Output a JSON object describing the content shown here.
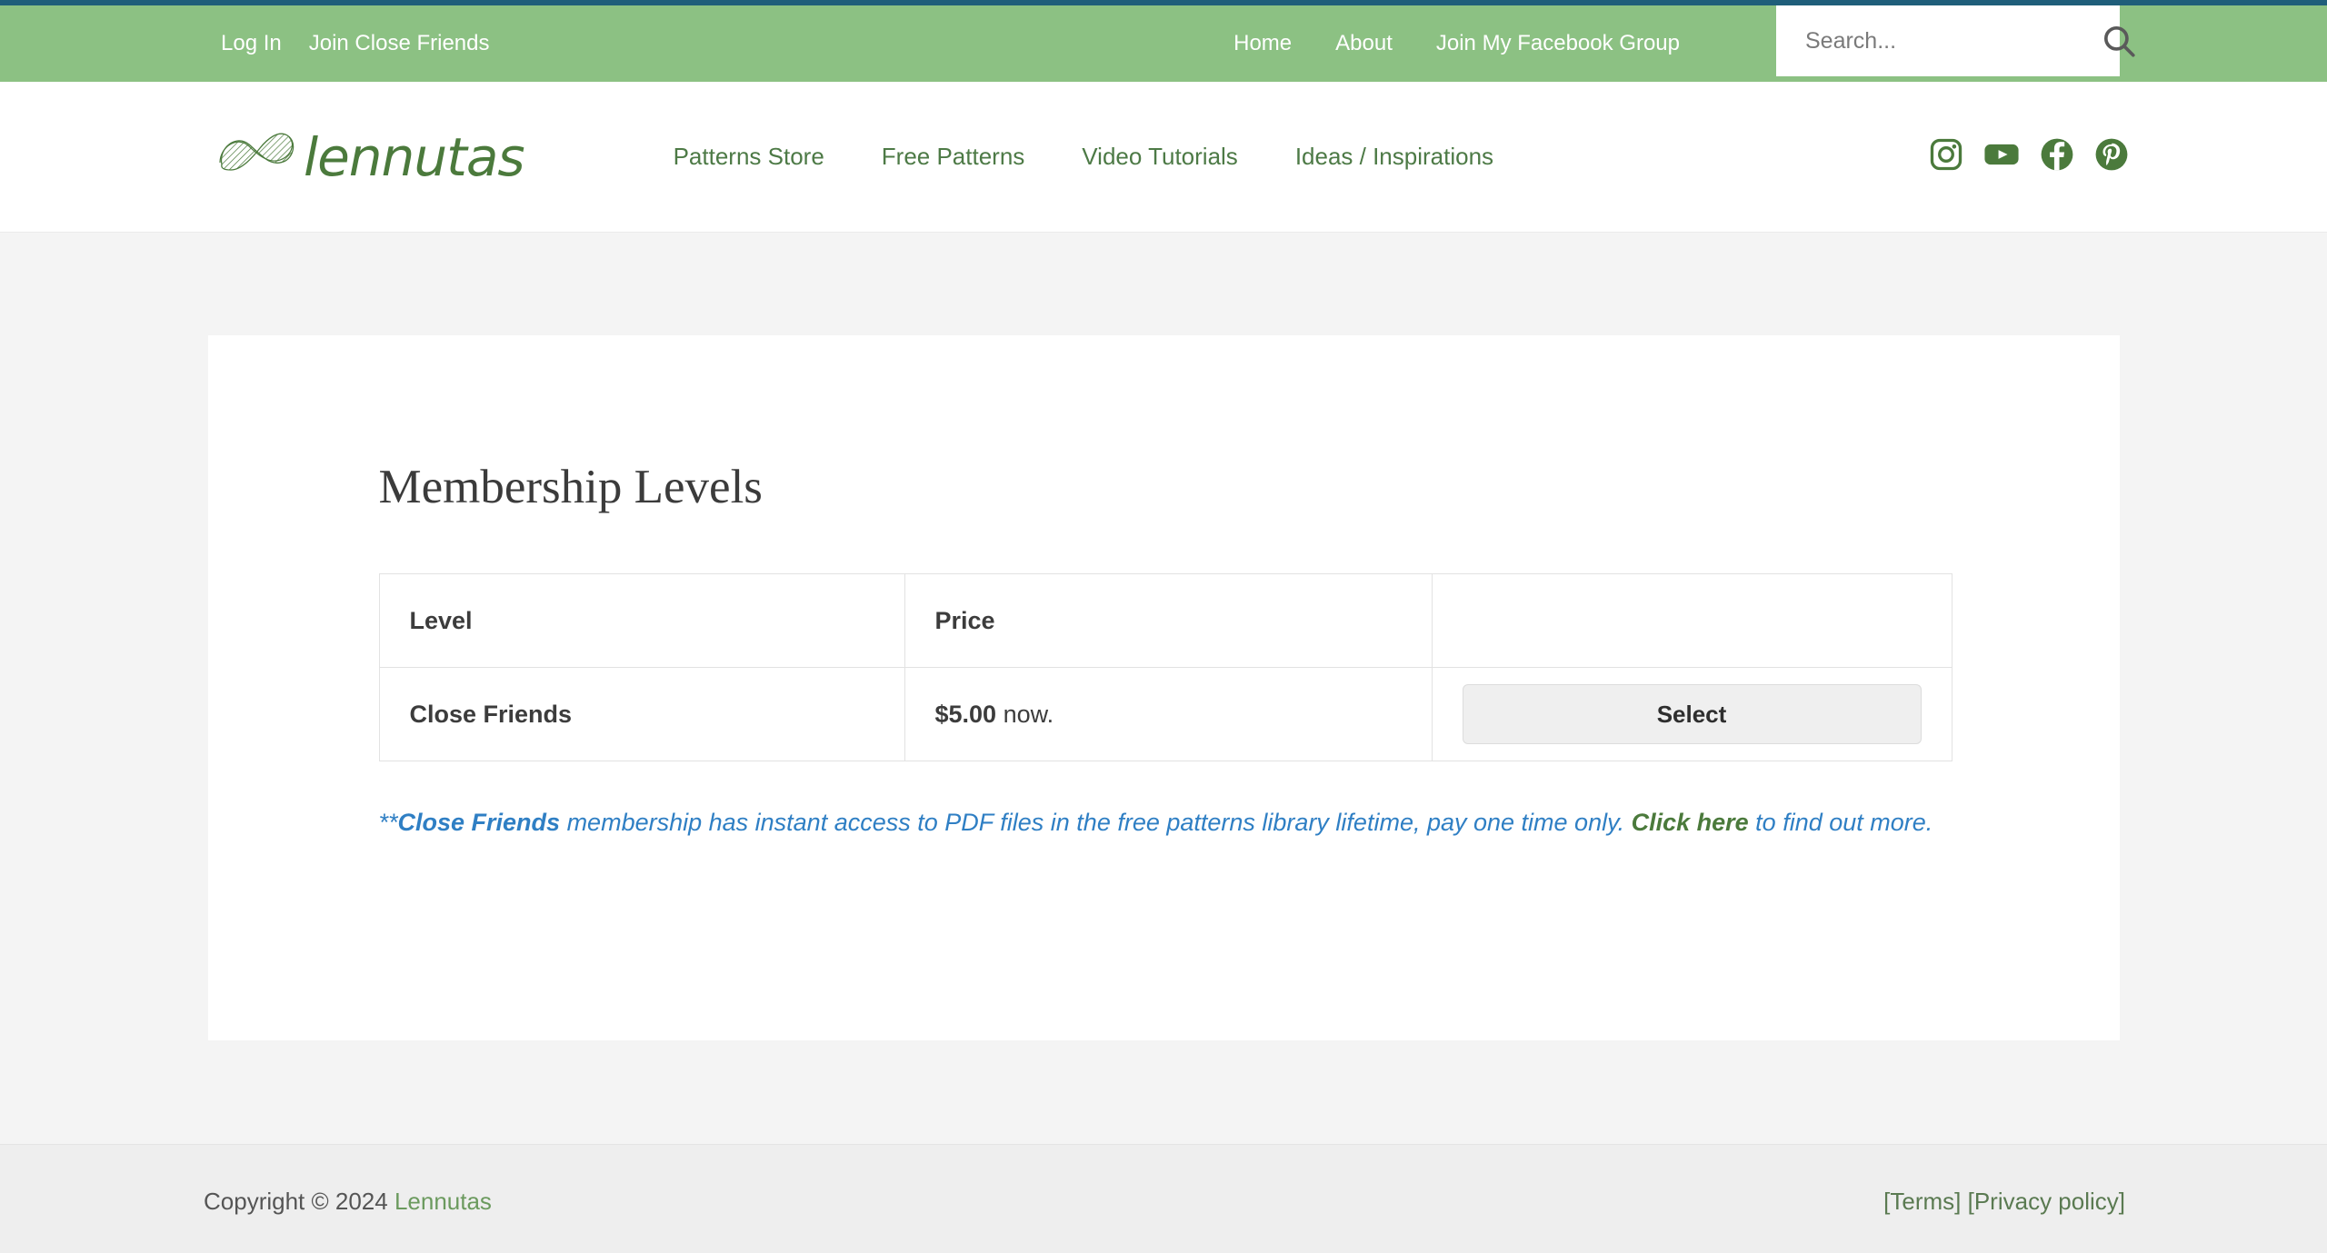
{
  "theme": {
    "accent_strip": "#1f5e7a",
    "utility_bar_bg": "#8cc183",
    "brand_green": "#4b7a3c",
    "nav_green": "#4d7a46",
    "note_blue": "#2f7fc4",
    "page_bg": "#f4f4f4",
    "footer_bg": "#eeeeee"
  },
  "utility_bar": {
    "left_links": [
      {
        "label": "Log In",
        "name": "log-in-link"
      },
      {
        "label": "Join Close Friends",
        "name": "join-close-friends-link"
      }
    ],
    "right_links": [
      {
        "label": "Home",
        "name": "home-link"
      },
      {
        "label": "About",
        "name": "about-link"
      },
      {
        "label": "Join My Facebook Group",
        "name": "join-facebook-group-link"
      }
    ],
    "search": {
      "placeholder": "Search...",
      "value": "",
      "icon": "search-icon"
    }
  },
  "header": {
    "logo_text": "lennutas",
    "logo_mark": "yarn-knot-icon",
    "nav": [
      {
        "label": "Patterns Store",
        "name": "patterns-store"
      },
      {
        "label": "Free Patterns",
        "name": "free-patterns"
      },
      {
        "label": "Video Tutorials",
        "name": "video-tutorials"
      },
      {
        "label": "Ideas / Inspirations",
        "name": "ideas-inspirations"
      }
    ],
    "social": [
      {
        "name": "instagram-icon",
        "label": "Instagram"
      },
      {
        "name": "youtube-icon",
        "label": "YouTube"
      },
      {
        "name": "facebook-icon",
        "label": "Facebook"
      },
      {
        "name": "pinterest-icon",
        "label": "Pinterest"
      }
    ]
  },
  "main": {
    "title": "Membership Levels",
    "table": {
      "headers": [
        "Level",
        "Price",
        ""
      ],
      "rows": [
        {
          "level": "Close Friends",
          "price_amount": "$5.00",
          "price_suffix": " now.",
          "action_label": "Select"
        }
      ]
    },
    "note": {
      "prefix": "**",
      "bold_lead": "Close Friends",
      "body": " membership has instant access to PDF files in the free patterns library lifetime, pay one time only. ",
      "link_label": "Click here",
      "tail": " to find out more."
    }
  },
  "footer": {
    "copyright_prefix": "Copyright © 2024 ",
    "copyright_brand": "Lennutas",
    "links_open": "[",
    "terms_label": "Terms",
    "links_mid": "] [",
    "privacy_label": "Privacy policy",
    "links_close": "]"
  }
}
